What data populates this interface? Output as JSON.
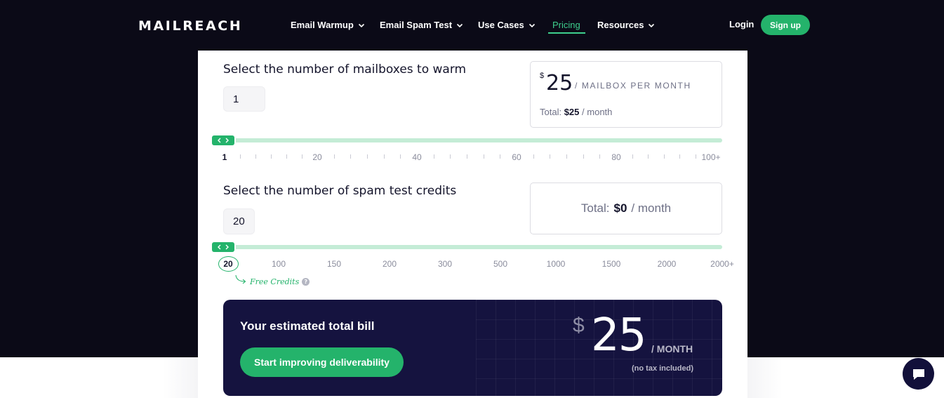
{
  "header": {
    "logo": "MAILREACH",
    "nav": [
      {
        "label": "Email Warmup",
        "has_dropdown": true
      },
      {
        "label": "Email Spam Test",
        "has_dropdown": true
      },
      {
        "label": "Use Cases",
        "has_dropdown": true
      },
      {
        "label": "Pricing",
        "has_dropdown": false,
        "active": true
      },
      {
        "label": "Resources",
        "has_dropdown": true
      }
    ],
    "login": "Login",
    "signup": "Sign up"
  },
  "mailboxes": {
    "title": "Select the number of mailboxes to warm",
    "value": "1",
    "price_currency": "$",
    "price": "25",
    "price_unit": "/ MAILBOX PER MONTH",
    "total_label": "Total:",
    "total_value": "$25",
    "total_suffix": "/ month",
    "slider_value": 1,
    "ticks": [
      "1",
      "20",
      "40",
      "60",
      "80",
      "100+"
    ]
  },
  "spam": {
    "title": "Select the number of spam test credits",
    "value": "20",
    "total_label": "Total:",
    "total_value": "$0",
    "total_suffix": "/ month",
    "slider_value": 20,
    "ticks": [
      "20",
      "100",
      "150",
      "200",
      "300",
      "500",
      "1000",
      "1500",
      "2000",
      "2000+"
    ],
    "free_credits": "Free Credits",
    "help_glyph": "?"
  },
  "bill": {
    "title": "Your estimated total bill",
    "button": "Start improving deliverability",
    "currency": "$",
    "amount": "25",
    "unit": "/ MONTH",
    "note": "(no tax included)"
  },
  "colors": {
    "background": "#0b0a17",
    "accent": "#24b36b",
    "accent_light": "#c4ecd6",
    "bill_bg": "#15133f"
  },
  "icons": {
    "nav_dropdown": "chevron-down-icon",
    "slider_thumb": "chevron-left-right-icon",
    "free_credits_arrow": "curved-arrow-icon",
    "help": "question-icon",
    "chat": "chat-bubble-icon"
  }
}
